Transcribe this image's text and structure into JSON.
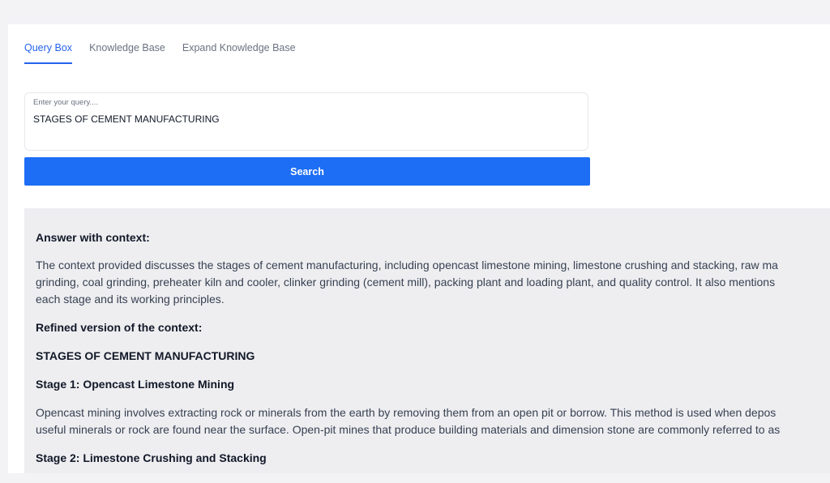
{
  "tabs": [
    {
      "label": "Query Box",
      "active": true
    },
    {
      "label": "Knowledge Base",
      "active": false
    },
    {
      "label": "Expand Knowledge Base",
      "active": false
    }
  ],
  "query": {
    "label": "Enter your query....",
    "value": "STAGES OF CEMENT MANUFACTURING"
  },
  "search_button": {
    "label": "Search"
  },
  "answer": {
    "heading": "Answer with context:",
    "context_lines": [
      "The context provided discusses the stages of cement manufacturing, including opencast limestone mining, limestone crushing and stacking, raw ma",
      "grinding, coal grinding, preheater kiln and cooler, clinker grinding (cement mill), packing plant and loading plant, and quality control. It also mentions",
      "each stage and its working principles."
    ],
    "refined_heading": "Refined version of the context:",
    "title": "STAGES OF CEMENT MANUFACTURING",
    "stage1_heading": "Stage 1: Opencast Limestone Mining",
    "stage1_lines": [
      "Opencast mining involves extracting rock or minerals from the earth by removing them from an open pit or borrow. This method is used when depos",
      "useful minerals or rock are found near the surface. Open-pit mines that produce building materials and dimension stone are commonly referred to as"
    ],
    "stage2_heading": "Stage 2: Limestone Crushing and Stacking"
  },
  "colors": {
    "accent": "#1d6ef5",
    "active_tab": "#2563eb",
    "page_bg": "#f3f3f6",
    "answer_bg": "#eeeef1"
  }
}
